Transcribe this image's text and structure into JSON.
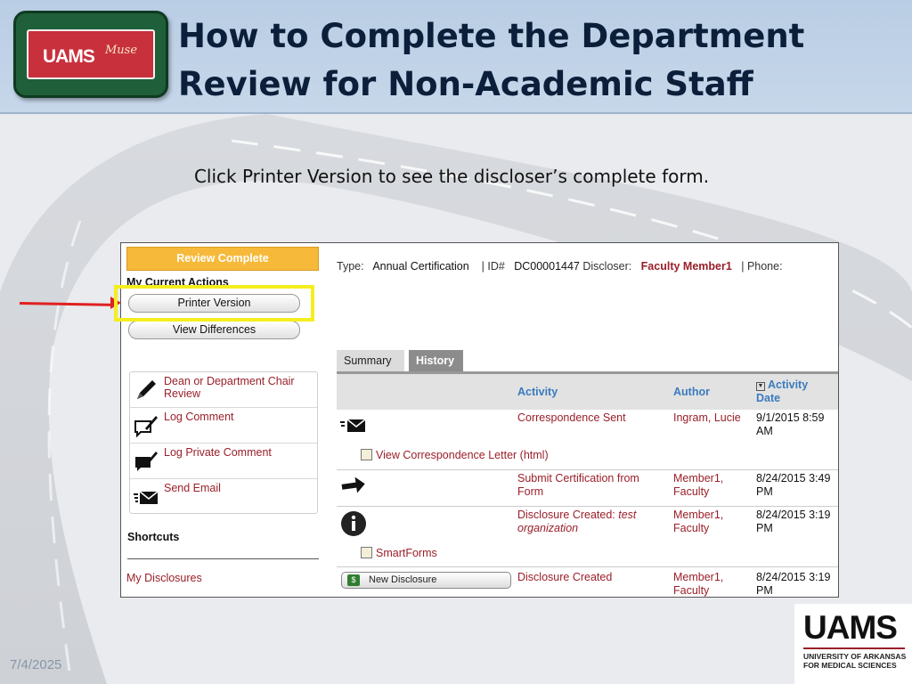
{
  "slide": {
    "title_line1": "How to Complete the Department",
    "title_line2": "Review for Non-Academic Staff",
    "instruction": "Click Printer Version to see the discloser’s complete form.",
    "date": "7/4/2025"
  },
  "logo": {
    "text": "UAMS",
    "script": "Muse"
  },
  "footer_logo": {
    "big": "UAMS",
    "sub_line1": "UNIVERSITY OF ARKANSAS",
    "sub_line2": "FOR MEDICAL SCIENCES"
  },
  "sidebar": {
    "status_button": "Review Complete",
    "my_current_actions": "My Current Actions",
    "printer_version": "Printer Version",
    "view_differences": "View Differences",
    "actions": [
      {
        "label": "Dean or Department Chair Review",
        "icon": "pencil-icon"
      },
      {
        "label": "Log Comment",
        "icon": "comment-icon"
      },
      {
        "label": "Log Private Comment",
        "icon": "private-comment-icon"
      },
      {
        "label": "Send Email",
        "icon": "email-icon"
      }
    ],
    "shortcuts_title": "Shortcuts",
    "my_disclosures": "My Disclosures"
  },
  "meta": {
    "type_label": "Type:",
    "type_value": "Annual Certification",
    "id_label": "| ID#",
    "id_value": "DC00001447",
    "discloser_label": "Discloser:",
    "discloser_value": "Faculty Member1",
    "phone_label": "| Phone:"
  },
  "tabs": {
    "summary": "Summary",
    "history": "History"
  },
  "history": {
    "col_activity": "Activity",
    "col_author": "Author",
    "col_date_line1": "Activity",
    "col_date_line2": "Date",
    "rows": [
      {
        "activity": "Correspondence Sent",
        "author": "Ingram, Lucie",
        "date": "9/1/2015 8:59 AM",
        "sublink": "View Correspondence Letter (html)",
        "icon": "envelope-icon"
      },
      {
        "activity": "Submit Certification from Form",
        "author": "Member1, Faculty",
        "date": "8/24/2015 3:49 PM",
        "icon": "arrow-right-icon"
      },
      {
        "activity_plain": "Disclosure Created: ",
        "activity_italic": "test organization",
        "author": "Member1, Faculty",
        "date": "8/24/2015 3:19 PM",
        "sublink": "SmartForms",
        "icon": "info-icon"
      },
      {
        "activity": "Disclosure Created",
        "author": "Member1, Faculty",
        "date": "8/24/2015 3:19 PM",
        "button": "New Disclosure",
        "icon": "dollar-icon"
      }
    ]
  },
  "colors": {
    "header_bg": "#c2d3e8",
    "title": "#0b1f3a",
    "link_red": "#9a1f2a",
    "review_orange": "#f6b93a",
    "highlight_yellow": "#f4ee1f",
    "arrow_red": "#e02020",
    "column_blue": "#3a7bbf"
  }
}
